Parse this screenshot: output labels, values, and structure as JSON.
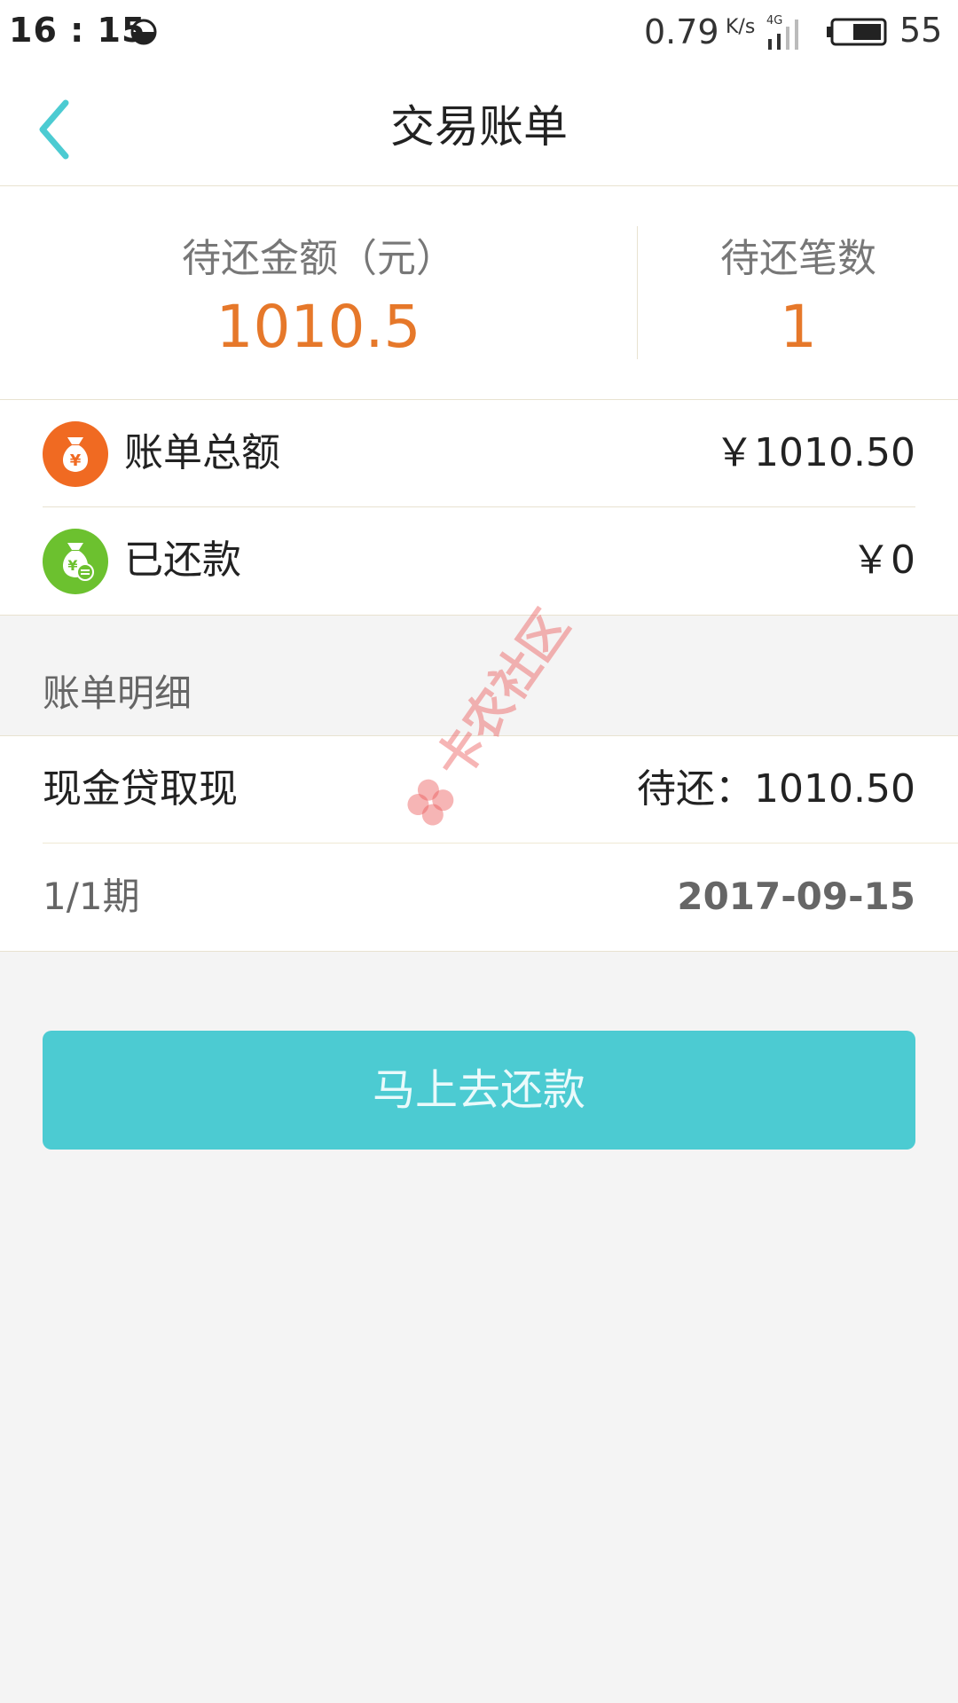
{
  "status_bar": {
    "time": "16 : 15",
    "net_speed": "0.79",
    "net_speed_unit": "K/s",
    "network_type": "4G",
    "battery": "55"
  },
  "header": {
    "title": "交易账单",
    "back_icon": "chevron-left-icon"
  },
  "summary": {
    "pending_amount_label": "待还金额（元）",
    "pending_amount_value": "1010.5",
    "pending_count_label": "待还笔数",
    "pending_count_value": "1"
  },
  "totals": [
    {
      "label": "账单总额",
      "value": "￥1010.50",
      "icon": "money-bag-icon",
      "icon_color": "#f06a22"
    },
    {
      "label": "已还款",
      "value": "￥0",
      "icon": "money-bag-paid-icon",
      "icon_color": "#6cc12f"
    }
  ],
  "details": {
    "header": "账单明细",
    "item_name": "现金贷取现",
    "item_due": "待还：1010.50",
    "period": "1/1期",
    "due_date": "2017-09-15"
  },
  "watermark": "卡农社区",
  "action": {
    "pay_label": "马上去还款"
  },
  "colors": {
    "accent": "#4ccbd2",
    "amount": "#e6782a",
    "background": "#f4f4f4"
  }
}
